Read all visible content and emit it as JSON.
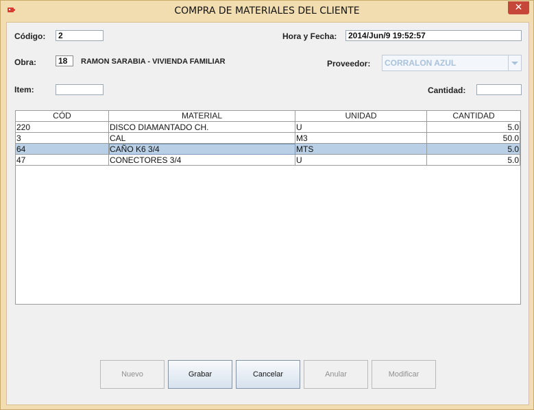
{
  "window": {
    "title": "COMPRA DE MATERIALES DEL CLIENTE",
    "close_glyph": "✕"
  },
  "form": {
    "codigo_label": "Código:",
    "codigo_value": "2",
    "hora_fecha_label": "Hora y Fecha:",
    "hora_fecha_value": "2014/Jun/9 19:52:57",
    "obra_label": "Obra:",
    "obra_value": "18",
    "obra_name": "RAMON SARABIA - VIVIENDA FAMILIAR",
    "proveedor_label": "Proveedor:",
    "proveedor_value": "CORRALON AZUL",
    "item_label": "Item:",
    "item_value": "",
    "cantidad_label": "Cantidad:",
    "cantidad_value": ""
  },
  "table": {
    "columns": [
      "CÓD",
      "MATERIAL",
      "UNIDAD",
      "CANTIDAD"
    ],
    "rows": [
      {
        "cod": "220",
        "material": "DISCO DIAMANTADO CH.",
        "unidad": "U",
        "cantidad": "5.0"
      },
      {
        "cod": "3",
        "material": "CAL",
        "unidad": "M3",
        "cantidad": "50.0"
      },
      {
        "cod": "64",
        "material": "CAÑO K6 3/4",
        "unidad": "MTS",
        "cantidad": "5.0"
      },
      {
        "cod": "47",
        "material": "CONECTORES 3/4",
        "unidad": "U",
        "cantidad": "5.0"
      }
    ],
    "selected_row": 2
  },
  "buttons": {
    "nuevo": "Nuevo",
    "grabar": "Grabar",
    "cancelar": "Cancelar",
    "anular": "Anular",
    "modificar": "Modificar"
  },
  "colors": {
    "title_bar": "#f2ddb1",
    "close_button": "#c7463a",
    "selected_row": "#b8cfe5"
  }
}
